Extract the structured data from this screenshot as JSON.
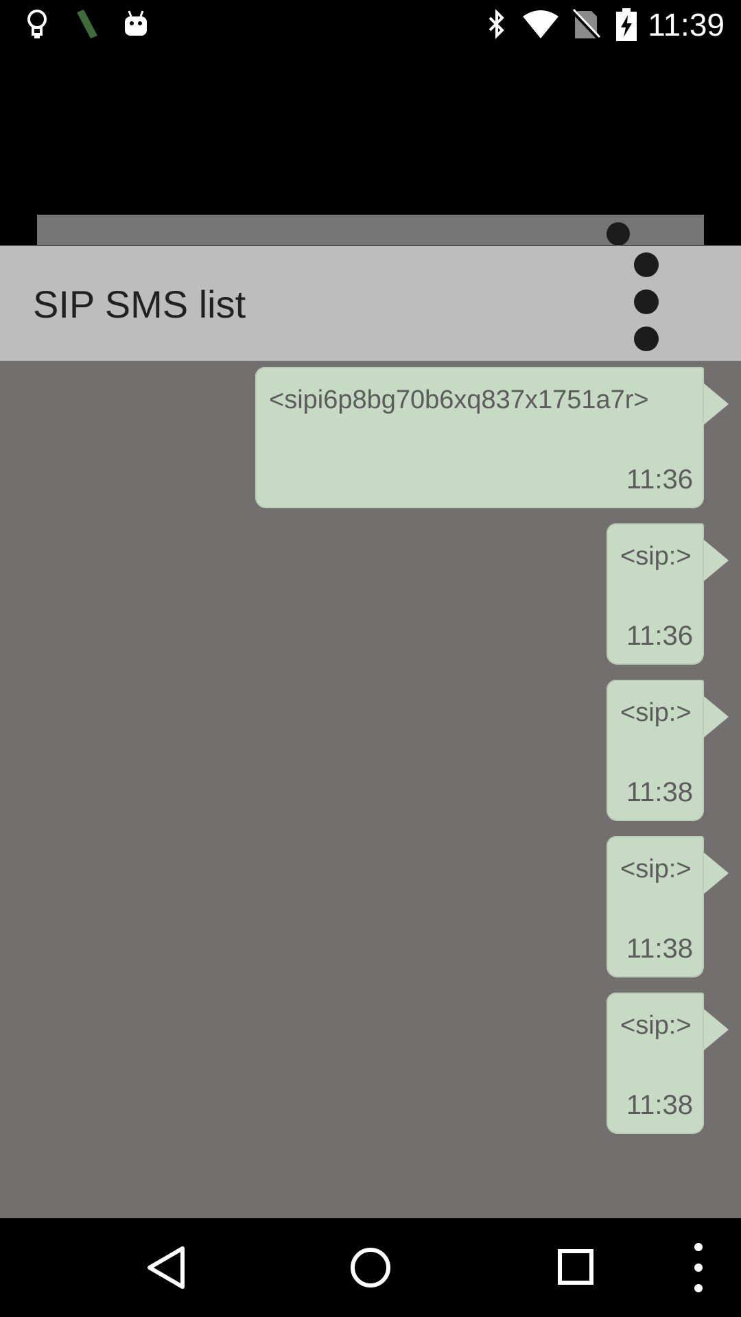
{
  "status_bar": {
    "time": "11:39",
    "left_icons": [
      "lightbulb-icon",
      "usb-debug-icon",
      "android-icon"
    ],
    "right_icons": [
      "bluetooth-icon",
      "wifi-icon",
      "no-sim-icon",
      "battery-charging-icon"
    ]
  },
  "app_bar": {
    "title": "SIP SMS list",
    "menu_icon": "overflow-menu-icon"
  },
  "messages": [
    {
      "text": "<sipi6p8bg70b6xq837x1751a7r>",
      "time": "11:36"
    },
    {
      "text": "<sip:>",
      "time": "11:36"
    },
    {
      "text": "<sip:>",
      "time": "11:38"
    },
    {
      "text": "<sip:>",
      "time": "11:38"
    },
    {
      "text": "<sip:>",
      "time": "11:38"
    }
  ],
  "nav_bar": {
    "buttons": [
      "back-icon",
      "home-icon",
      "recents-icon",
      "menu-icon"
    ]
  },
  "colors": {
    "bubble": "#c7dac4",
    "list_background": "#736f6f",
    "app_bar": "#bdbdbd"
  }
}
